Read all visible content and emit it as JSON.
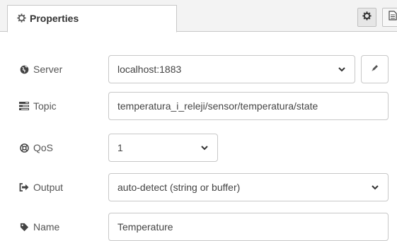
{
  "tabs": {
    "properties_label": "Properties"
  },
  "form": {
    "server": {
      "label": "Server",
      "value": "localhost:1883"
    },
    "topic": {
      "label": "Topic",
      "value": "temperatura_i_releji/sensor/temperatura/state"
    },
    "qos": {
      "label": "QoS",
      "value": "1"
    },
    "output": {
      "label": "Output",
      "value": "auto-detect (string or buffer)"
    },
    "name": {
      "label": "Name",
      "value": "Temperature"
    }
  },
  "icons": {
    "tab": "gear-icon",
    "server": "globe-icon",
    "topic": "tasks-icon",
    "qos": "life-ring-icon",
    "output": "sign-out-icon",
    "name": "tag-icon",
    "edit": "pencil-icon",
    "settings": "gear-icon",
    "description": "file-text-icon"
  },
  "colors": {
    "border": "#c8c8c8",
    "text": "#444444",
    "label": "#555555"
  }
}
